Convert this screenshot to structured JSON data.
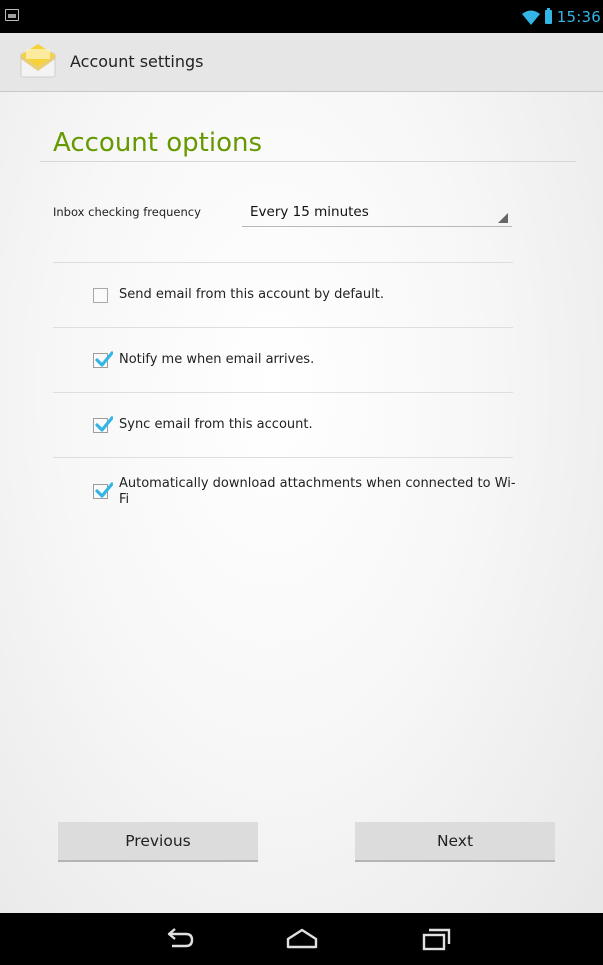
{
  "status_bar": {
    "time": "15:36",
    "icons": [
      "image-notification-icon",
      "wifi-icon",
      "battery-icon"
    ],
    "accent_color": "#33b5e5"
  },
  "action_bar": {
    "title": "Account settings",
    "icon": "email-envelope-icon"
  },
  "section": {
    "title": "Account options",
    "title_color": "#669900"
  },
  "inbox_frequency": {
    "label": "Inbox checking frequency",
    "selected": "Every 15 minutes"
  },
  "options": [
    {
      "label": "Send email from this account by default.",
      "checked": false
    },
    {
      "label": "Notify me when email arrives.",
      "checked": true
    },
    {
      "label": "Sync email from this account.",
      "checked": true
    },
    {
      "label": "Automatically download attachments when connected to Wi-Fi",
      "checked": true
    }
  ],
  "buttons": {
    "previous": "Previous",
    "next": "Next"
  },
  "nav_bar": {
    "icons": [
      "back-icon",
      "home-icon",
      "recent-apps-icon"
    ]
  },
  "colors": {
    "checkmark": "#33b5e5",
    "button_bg": "#dcdcdc"
  }
}
